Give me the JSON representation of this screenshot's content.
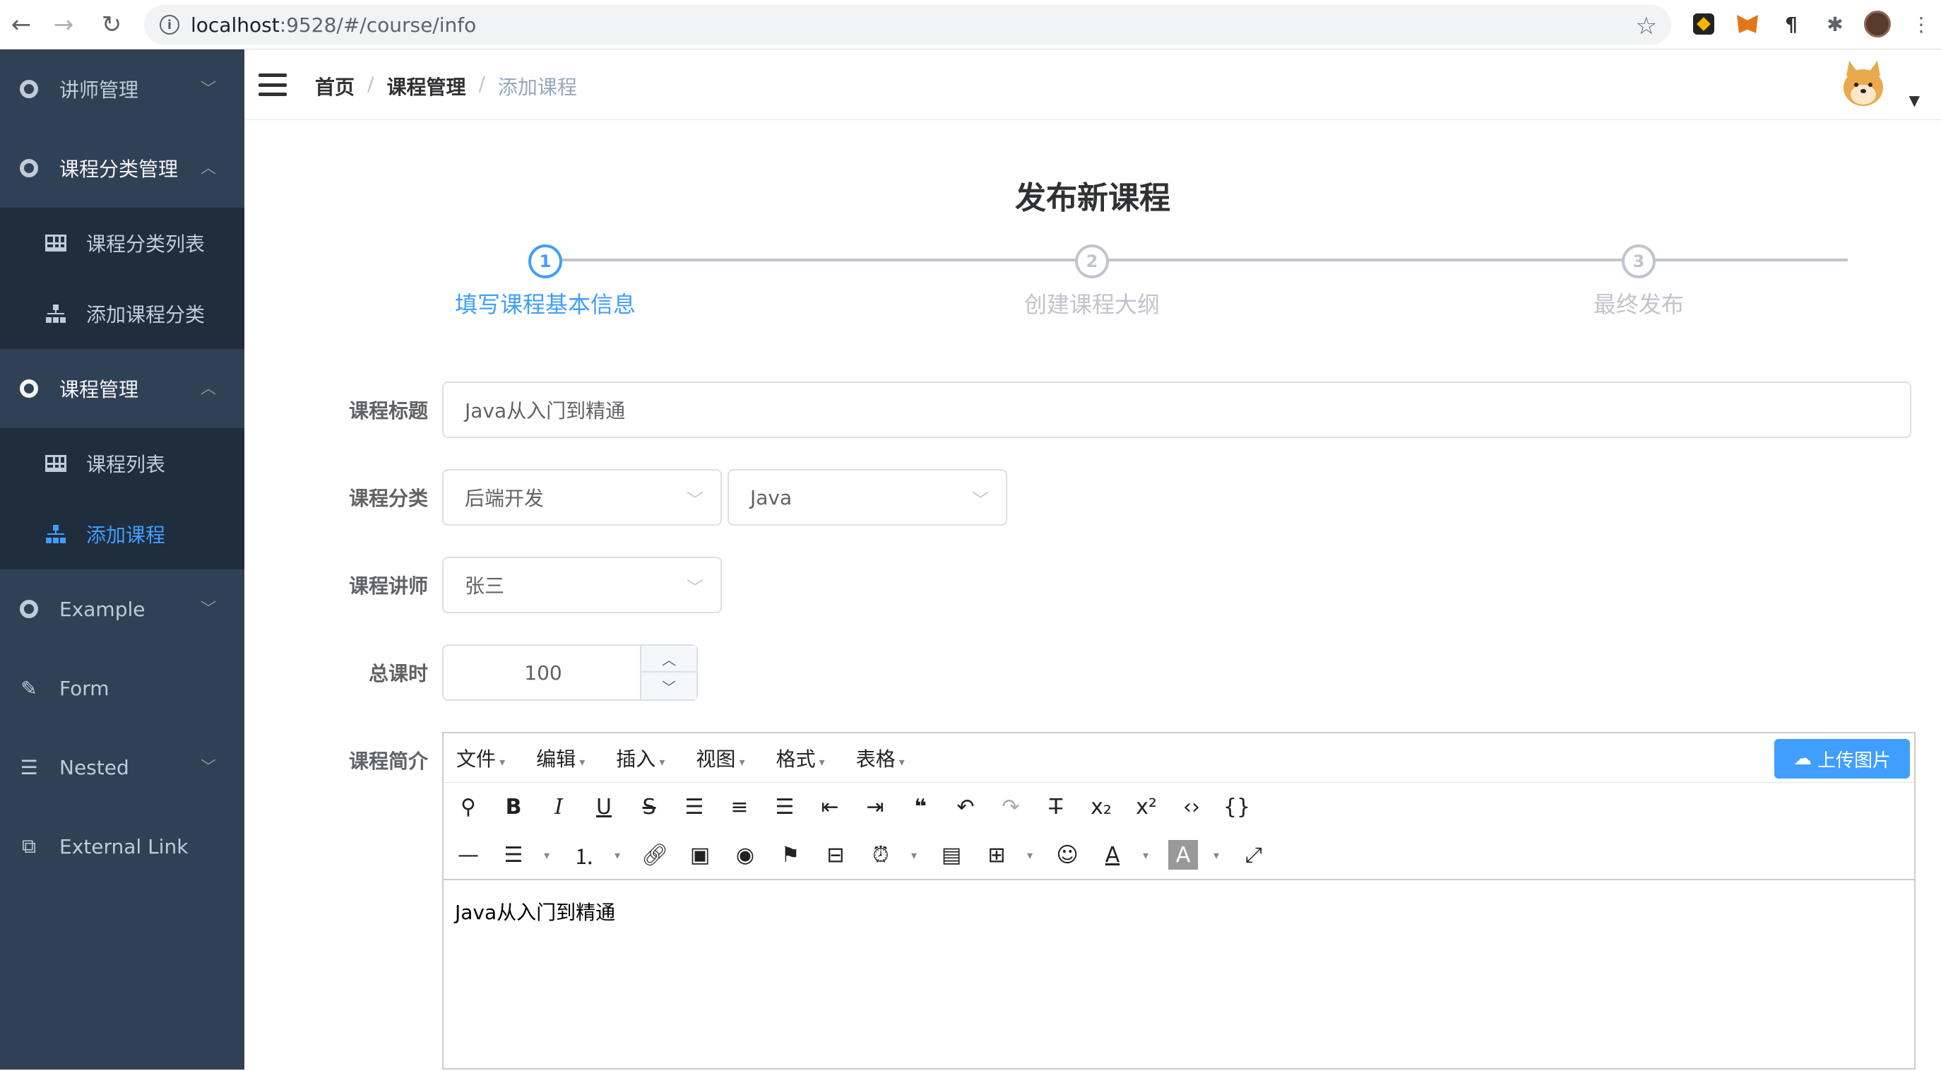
{
  "browser": {
    "url_host": "localhost",
    "url_rest": ":9528/#/course/info"
  },
  "sidebar": {
    "items": [
      {
        "label": "讲师管理",
        "icon": "circle-icon",
        "arrow": "chevron-down"
      },
      {
        "label": "课程分类管理",
        "icon": "circle-icon",
        "arrow": "chevron-up"
      },
      {
        "label": "课程分类列表",
        "icon": "table-icon"
      },
      {
        "label": "添加课程分类",
        "icon": "tree-icon"
      },
      {
        "label": "课程管理",
        "icon": "circle-icon",
        "arrow": "chevron-up"
      },
      {
        "label": "课程列表",
        "icon": "table-icon"
      },
      {
        "label": "添加课程",
        "icon": "tree-icon"
      },
      {
        "label": "Example",
        "icon": "circle-icon",
        "arrow": "chevron-down"
      },
      {
        "label": "Form",
        "icon": "form-icon"
      },
      {
        "label": "Nested",
        "icon": "list-icon",
        "arrow": "chevron-down"
      },
      {
        "label": "External Link",
        "icon": "external-link-icon"
      }
    ]
  },
  "breadcrumb": {
    "home": "首页",
    "section": "课程管理",
    "current": "添加课程",
    "separator": "/"
  },
  "page": {
    "title": "发布新课程"
  },
  "steps": [
    {
      "number": "1",
      "label": "填写课程基本信息",
      "active": true
    },
    {
      "number": "2",
      "label": "创建课程大纲",
      "active": false
    },
    {
      "number": "3",
      "label": "最终发布",
      "active": false
    }
  ],
  "form": {
    "title_label": "课程标题",
    "title_value": "Java从入门到精通",
    "category_label": "课程分类",
    "category_primary": "后端开发",
    "category_secondary": "Java",
    "teacher_label": "课程讲师",
    "teacher_value": "张三",
    "hours_label": "总课时",
    "hours_value": "100",
    "intro_label": "课程简介"
  },
  "editor": {
    "menus": [
      "文件",
      "编辑",
      "插入",
      "视图",
      "格式",
      "表格"
    ],
    "upload_label": "上传图片",
    "content": "Java从入门到精通"
  },
  "colors": {
    "accent": "#409eff",
    "sidebar_bg": "#304156",
    "submenu_bg": "#1f2d3d",
    "sidebar_text": "#bfcbd9",
    "step_inactive": "#c0c4cc"
  }
}
